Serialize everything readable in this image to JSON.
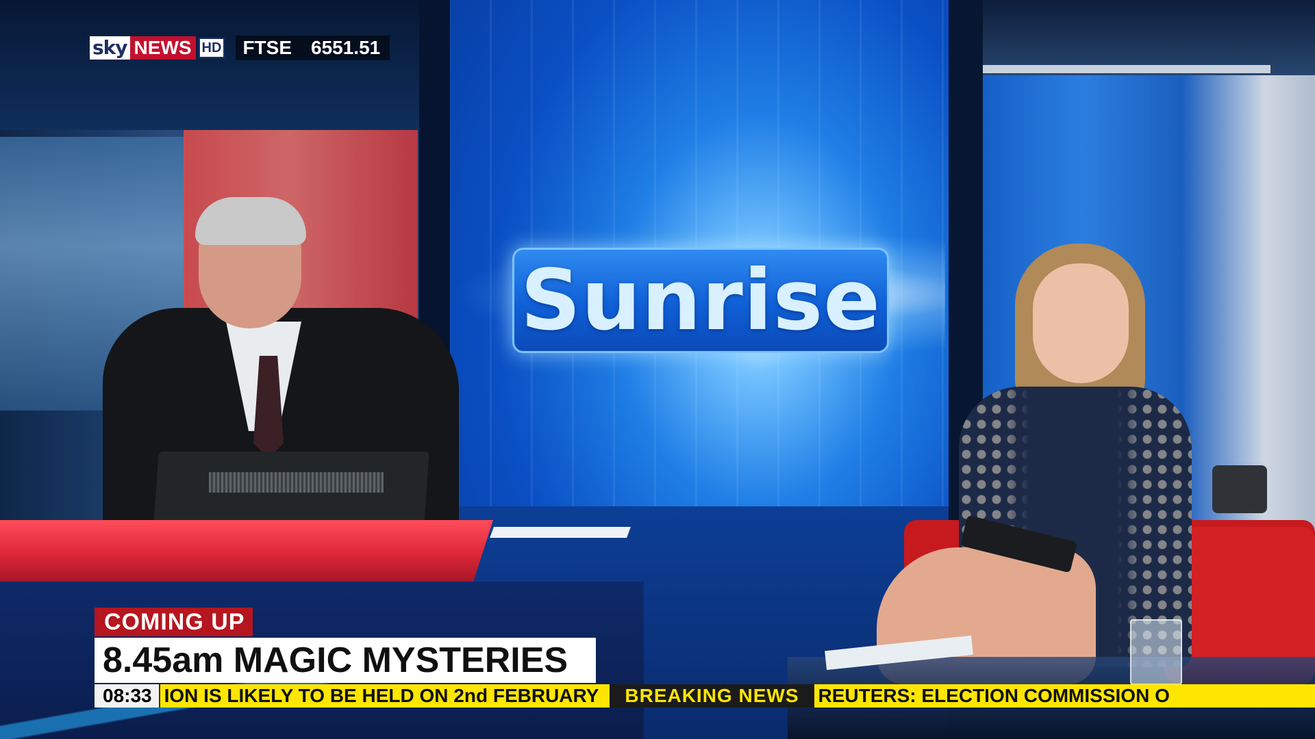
{
  "channel": {
    "brand_sky": "sky",
    "brand_news": "NEWS",
    "brand_hd": "HD",
    "market_label": "FTSE",
    "market_value": "6551.51"
  },
  "program": {
    "logo_text": "Sunrise"
  },
  "lower_third": {
    "tag": "COMING UP",
    "headline": "8.45am MAGIC MYSTERIES"
  },
  "ticker": {
    "time": "08:33",
    "segment_1": "ION IS LIKELY TO BE HELD ON 2nd FEBRUARY",
    "breaking_label": "BREAKING NEWS",
    "segment_2": "REUTERS: ELECTION COMMISSION O"
  },
  "colors": {
    "sky_news_red": "#c3102f",
    "coming_up_red": "#b5161f",
    "ticker_yellow": "#ffe600",
    "studio_blue": "#0a4fc4"
  }
}
